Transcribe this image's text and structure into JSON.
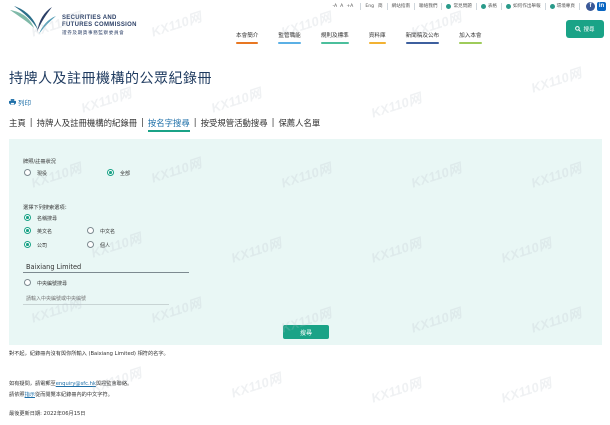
{
  "header": {
    "logo_en_line1": "SECURITIES AND",
    "logo_en_line2": "FUTURES COMMISSION",
    "logo_cn": "證券及期貨事務監察委員會",
    "font_size_controls": [
      "-A",
      "A",
      "+A"
    ],
    "language_links": [
      "Eng",
      "简"
    ],
    "utility_links": [
      "網站指南",
      "聯絡我們",
      "常見問題",
      "表格",
      "如何作出舉報",
      "環境專頁"
    ],
    "social_icons": [
      "facebook-icon",
      "linkedin-icon"
    ],
    "nav": [
      "本會簡介",
      "監管職能",
      "規則及標準",
      "資料庫",
      "新聞稿及公布",
      "加入本會"
    ],
    "search_label": "搜尋",
    "brand_color": "#1aa387"
  },
  "page": {
    "title": "持牌人及註冊機構的公眾紀錄冊",
    "print_label": "列印",
    "subnav": [
      "主頁",
      "持牌人及註冊機構的紀錄冊",
      "按名字搜尋",
      "按受規管活動搜尋",
      "保薦人名單"
    ],
    "subnav_active_index": 2
  },
  "form": {
    "status_label": "牌照/註冊狀況",
    "status_options": [
      "現役",
      "全部"
    ],
    "status_selected": "全部",
    "criteria_label": "選擇下列搜索選項：",
    "by_name_label": "名稱搜尋",
    "lang_options": [
      "英文名",
      "中文名"
    ],
    "lang_selected": "英文名",
    "type_options": [
      "公司",
      "個人"
    ],
    "type_selected": "公司",
    "name_value": "Baixiang Limited",
    "ce_label": "中央編號搜尋",
    "ce_placeholder": "請輸入中央編號或中央編號",
    "submit_label": "搜尋"
  },
  "notes": {
    "no_result": "對不起，紀錄冊內沒有與你所輸入 (Baixiang Limited) 相符的名字。",
    "contact_prefix": "如有疑問，請電郵至",
    "contact_email": "enquiry@sfc.hk",
    "contact_suffix": "與證監會聯絡。",
    "guide_prefix": "請依照",
    "guide_link": "指示",
    "guide_suffix": "從而閱覽本紀錄冊內的中文字符。",
    "last_updated": "最後更新日期: 2022年06月15日"
  },
  "watermark_text": "KX110网"
}
